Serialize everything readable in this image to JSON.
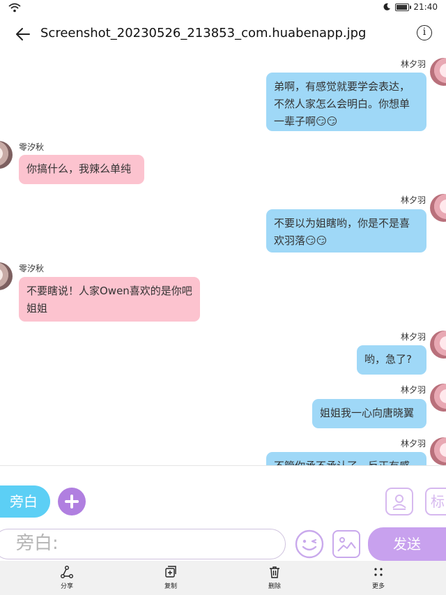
{
  "status_bar": {
    "time": "21:40",
    "icons": [
      "wifi-icon",
      "moon-icon",
      "battery-icon"
    ],
    "battery_level": 0.8
  },
  "header": {
    "title": "Screenshot_20230526_213853_com.huabenapp.jpg",
    "back_icon": "arrow-left-icon",
    "info_icon": "info-icon"
  },
  "messages": [
    {
      "sender": "林夕羽",
      "side": "right",
      "text": "弟啊，有感觉就要学会表达，不然人家怎么会明白。你想单一辈子啊😏😏"
    },
    {
      "sender": "零汐秋",
      "side": "left",
      "text": "你搞什么，我辣么单纯"
    },
    {
      "sender": "林夕羽",
      "side": "right",
      "text": "不要以为姐瞎哟，你是不是喜欢羽落😏😏"
    },
    {
      "sender": "零汐秋",
      "side": "left",
      "text": "不要瞎说！人家Owen喜欢的是你吧姐姐"
    },
    {
      "sender": "林夕羽",
      "side": "right",
      "text": "哟，急了?"
    },
    {
      "sender": "林夕羽",
      "side": "right",
      "text": "姐姐我一心向唐晓翼"
    },
    {
      "sender": "林夕羽",
      "side": "right",
      "text": "不管你承不承认了，反正有感"
    }
  ],
  "composer": {
    "aside_label": "旁白",
    "input_placeholder": "旁白:",
    "send_label": "发送",
    "tag_label": "标",
    "icons": [
      "plus-icon",
      "role-card-icon",
      "emoji-icon",
      "image-icon"
    ]
  },
  "toolbar": [
    {
      "label": "分享",
      "icon": "share-icon"
    },
    {
      "label": "复制",
      "icon": "copy-icon"
    },
    {
      "label": "删除",
      "icon": "delete-icon"
    },
    {
      "label": "更多",
      "icon": "more-icon"
    }
  ],
  "colors": {
    "right_bubble": "#9fd8f7",
    "left_bubble": "#fcc3cf",
    "accent_blue": "#5ccff5",
    "accent_purple": "#c8a1ee"
  }
}
